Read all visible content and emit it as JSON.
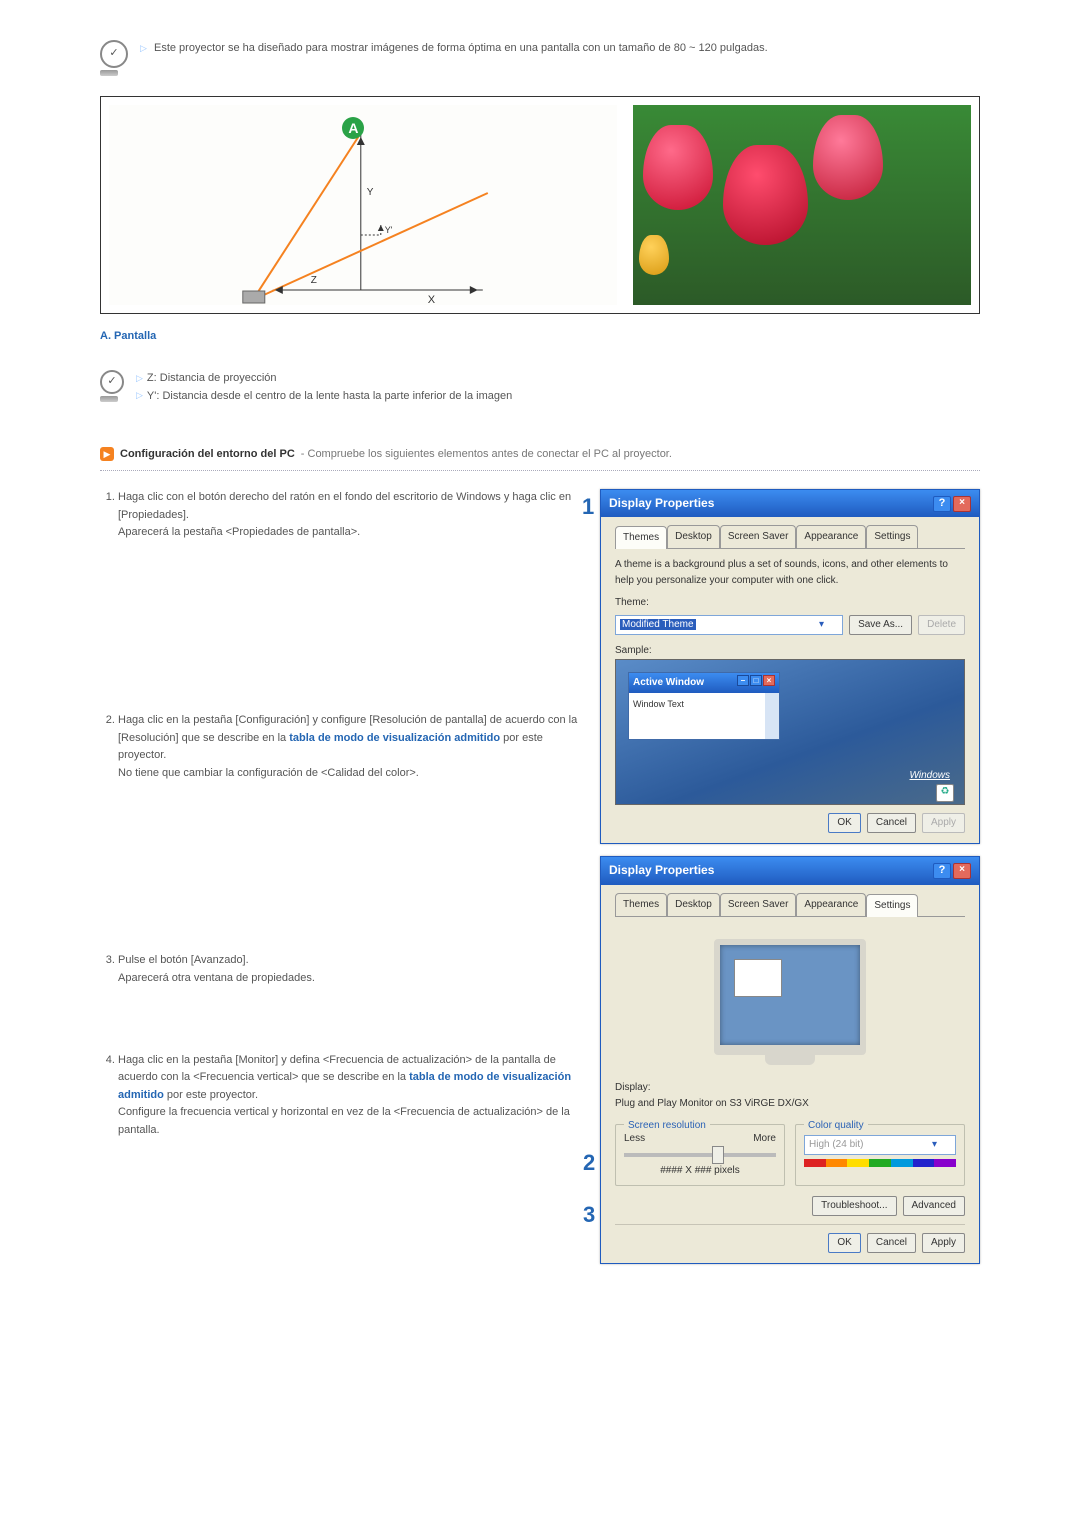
{
  "topNote": "Este proyector se ha diseñado para mostrar imágenes de forma óptima en una pantalla con un tamaño de 80 ~ 120 pulgadas.",
  "badgeA": "A",
  "labelA": "A. Pantalla",
  "distance": {
    "z": "Z: Distancia de proyección",
    "y": "Y': Distancia desde el centro de la lente hasta la parte inferior de la imagen"
  },
  "section": {
    "title": "Configuración del entorno del PC",
    "sub": " - Compruebe los siguientes elementos antes de conectar el PC al proyector."
  },
  "steps": {
    "s1a": "Haga clic con el botón derecho del ratón en el fondo del escritorio de Windows y haga clic en [Propiedades].",
    "s1b": "Aparecerá la pestaña <Propiedades de pantalla>.",
    "s2a": "Haga clic en la pestaña [Configuración] y configure [Resolución de pantalla] de acuerdo con la [Resolución] que se describe en la ",
    "s2link": "tabla de modo de visualización admitido",
    "s2b": " por este proyector.",
    "s2c": "No tiene que cambiar la configuración de <Calidad del color>.",
    "s3a": "Pulse el botón [Avanzado].",
    "s3b": "Aparecerá otra ventana de propiedades.",
    "s4a": "Haga clic en la pestaña [Monitor] y defina <Frecuencia de actualización> de la pantalla de acuerdo con la <Frecuencia vertical> que se describe en la ",
    "s4link": "tabla de modo de visualización admitido",
    "s4b": " por este proyector.",
    "s4c": "Configure la frecuencia vertical y horizontal en vez de la <Frecuencia de actualización> de la pantalla."
  },
  "callouts": {
    "c1": "1",
    "c2": "2",
    "c3": "3"
  },
  "xp": {
    "title": "Display Properties",
    "tabs": [
      "Themes",
      "Desktop",
      "Screen Saver",
      "Appearance",
      "Settings"
    ],
    "themeDesc": "A theme is a background plus a set of sounds, icons, and other elements to help you personalize your computer with one click.",
    "themeLabel": "Theme:",
    "themeValue": "Modified Theme",
    "saveAs": "Save As...",
    "delete": "Delete",
    "sample": "Sample:",
    "activeWindow": "Active Window",
    "windowText": "Window Text",
    "windowsLogo": "Windows",
    "ok": "OK",
    "cancel": "Cancel",
    "apply": "Apply",
    "displayLabel": "Display:",
    "displayValue": "Plug and Play Monitor on S3 ViRGE DX/GX",
    "screenRes": "Screen resolution",
    "less": "Less",
    "more": "More",
    "pixels": "#### X ### pixels",
    "colorQuality": "Color quality",
    "colorValue": "High (24 bit)",
    "troubleshoot": "Troubleshoot...",
    "advanced": "Advanced"
  }
}
